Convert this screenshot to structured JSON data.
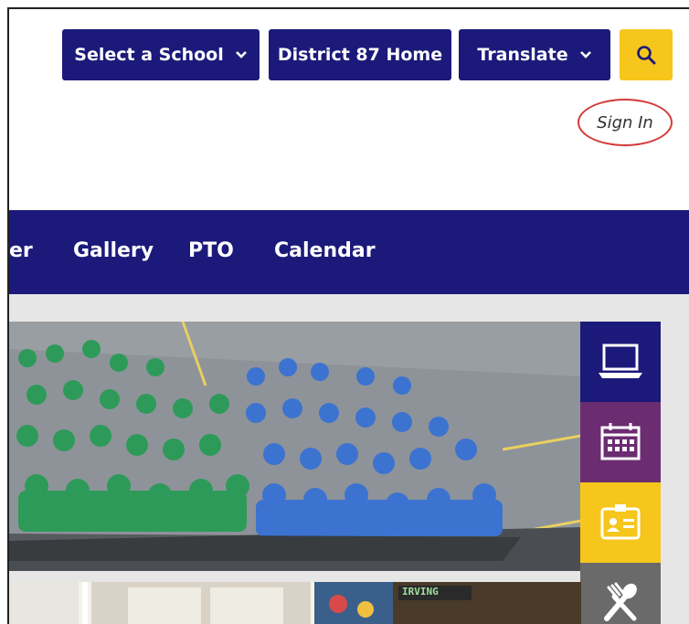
{
  "header": {
    "select_school_label": "Select a School",
    "district_home_label": "District 87 Home",
    "translate_label": "Translate",
    "sign_in_label": "Sign In"
  },
  "nav": {
    "items": [
      {
        "label": "er"
      },
      {
        "label": "Gallery"
      },
      {
        "label": "PTO"
      },
      {
        "label": "Calendar"
      }
    ]
  },
  "hero": {
    "alt": "Students in green and blue shirts posing on playground"
  },
  "side_icons": [
    {
      "name": "laptop-icon",
      "color": "#1b1a7a"
    },
    {
      "name": "calendar-icon",
      "color": "#6b2c71"
    },
    {
      "name": "id-card-icon",
      "color": "#f6c61d"
    },
    {
      "name": "utensils-icon",
      "color": "#6a6a6a"
    }
  ],
  "bottom_banner": {
    "text": "IRVING"
  },
  "colors": {
    "navy": "#1b1a7a",
    "gold": "#f6c61d",
    "purple": "#6b2c71",
    "gray": "#6a6a6a",
    "signin_circle": "#d63a3a"
  }
}
